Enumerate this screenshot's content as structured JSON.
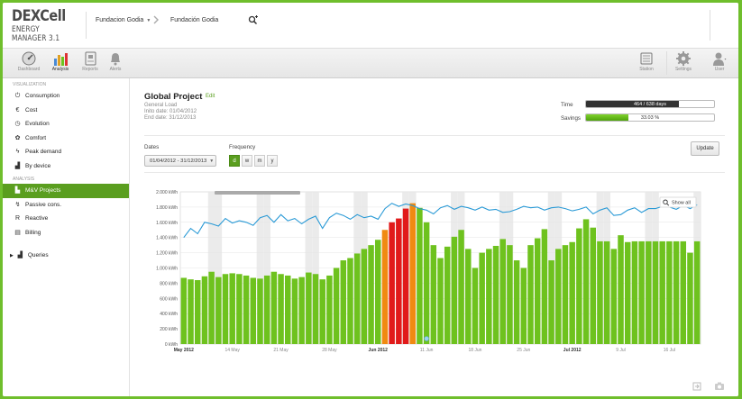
{
  "app": {
    "logo_line1": "DEXCell",
    "logo_line2": "ENERGY MANAGER 3.1"
  },
  "header": {
    "org": "Fundacion Godia",
    "site": "Fundación Godia"
  },
  "toolbar": {
    "dashboard": "Dashboard",
    "analysis": "Analysis",
    "reports": "Reports",
    "alerts": "Alerts",
    "station": "Station",
    "settings": "Settings",
    "user": "User"
  },
  "sidebar": {
    "visualization_label": "VISUALIZATION",
    "analysis_label": "ANALYSIS",
    "items": [
      {
        "label": "Consumption",
        "icon": "plug-icon"
      },
      {
        "label": "Cost",
        "icon": "euro-icon"
      },
      {
        "label": "Evolution",
        "icon": "clock-icon"
      },
      {
        "label": "Comfort",
        "icon": "comfort-icon"
      },
      {
        "label": "Peak demand",
        "icon": "peak-icon"
      },
      {
        "label": "By device",
        "icon": "device-icon"
      }
    ],
    "analysis_items": [
      {
        "label": "M&V Projects",
        "icon": "chart-icon"
      },
      {
        "label": "Passive cons.",
        "icon": "passive-icon"
      },
      {
        "label": "Reactive",
        "icon": "reactive-icon"
      },
      {
        "label": "Billing",
        "icon": "billing-icon"
      }
    ],
    "queries": "Queries"
  },
  "project": {
    "title": "Global Project",
    "edit": "Edit",
    "load": "General Load",
    "init": "Inito date: 01/04/2012",
    "end": "End date: 31/12/2013"
  },
  "progress": {
    "time_label": "Time",
    "time_text": "464 / 638 days",
    "time_fraction": 0.727,
    "savings_label": "Savings",
    "savings_text": "33.03 %",
    "savings_fraction": 0.33
  },
  "controls": {
    "dates_label": "Dates",
    "dates_value": "01/04/2012 - 31/12/2013",
    "frequency_label": "Frequency",
    "freq_options": [
      "d",
      "w",
      "m",
      "y"
    ],
    "update": "Update"
  },
  "chart_data": {
    "type": "bar",
    "show_all": "Show all",
    "yticks": [
      "2.000 kWh",
      "1.800 kWh",
      "1.600 kWh",
      "1.400 kWh",
      "1.200 kWh",
      "1.000 kWh",
      "800 kWh",
      "600 kWh",
      "400 kWh",
      "200 kWh",
      "0 kWh"
    ],
    "ylim": [
      0,
      2000
    ],
    "xticks": [
      {
        "label": "May 2012",
        "bold": true,
        "i": 0
      },
      {
        "label": "14 May",
        "bold": false,
        "i": 7
      },
      {
        "label": "21 May",
        "bold": false,
        "i": 14
      },
      {
        "label": "28 May",
        "bold": false,
        "i": 21
      },
      {
        "label": "Jun 2012",
        "bold": true,
        "i": 28
      },
      {
        "label": "11 Jun",
        "bold": false,
        "i": 35
      },
      {
        "label": "18 Jun",
        "bold": false,
        "i": 42
      },
      {
        "label": "25 Jun",
        "bold": false,
        "i": 49
      },
      {
        "label": "Jul 2012",
        "bold": true,
        "i": 56
      },
      {
        "label": "9 Jul",
        "bold": false,
        "i": 63
      },
      {
        "label": "16 Jul",
        "bold": false,
        "i": 70
      }
    ],
    "bars": [
      870,
      850,
      840,
      890,
      950,
      880,
      920,
      930,
      920,
      900,
      870,
      860,
      900,
      950,
      920,
      900,
      860,
      880,
      940,
      920,
      850,
      900,
      1000,
      1100,
      1130,
      1190,
      1250,
      1300,
      1370,
      1500,
      1600,
      1650,
      1780,
      1850,
      1790,
      1600,
      1300,
      1130,
      1280,
      1410,
      1500,
      1250,
      1000,
      1200,
      1250,
      1290,
      1380,
      1300,
      1100,
      1000,
      1300,
      1390,
      1510,
      1100,
      1250,
      1300,
      1340,
      1520,
      1640,
      1530,
      1350,
      1350,
      1250,
      1430,
      1340,
      1350,
      1350,
      1350,
      1350,
      1350,
      1350,
      1350,
      1350,
      1200,
      1350
    ],
    "bar_colors": {
      "normal": "#6ec21e",
      "orange": "#f08a12",
      "red": "#e11a1a"
    },
    "orange_idx": [
      29,
      33
    ],
    "red_idx": [
      30,
      31,
      32
    ],
    "line": [
      1400,
      1520,
      1450,
      1600,
      1580,
      1550,
      1650,
      1590,
      1620,
      1600,
      1560,
      1660,
      1690,
      1600,
      1700,
      1620,
      1650,
      1580,
      1640,
      1680,
      1520,
      1660,
      1720,
      1690,
      1640,
      1700,
      1660,
      1680,
      1640,
      1780,
      1850,
      1810,
      1840,
      1820,
      1780,
      1760,
      1710,
      1790,
      1820,
      1770,
      1810,
      1790,
      1760,
      1800,
      1760,
      1770,
      1730,
      1740,
      1770,
      1810,
      1790,
      1800,
      1760,
      1790,
      1800,
      1780,
      1750,
      1770,
      1800,
      1710,
      1760,
      1790,
      1690,
      1700,
      1760,
      1790,
      1730,
      1780,
      1780,
      1810,
      1800,
      1770,
      1820,
      1780,
      1830
    ],
    "gray_bands": [
      4,
      5,
      11,
      12,
      18,
      19,
      25,
      26,
      32,
      33,
      39,
      40,
      46,
      47,
      53,
      54,
      60,
      61,
      67,
      68,
      74
    ]
  },
  "footer": {
    "export_icon": "export-icon",
    "camera_icon": "camera-icon"
  }
}
